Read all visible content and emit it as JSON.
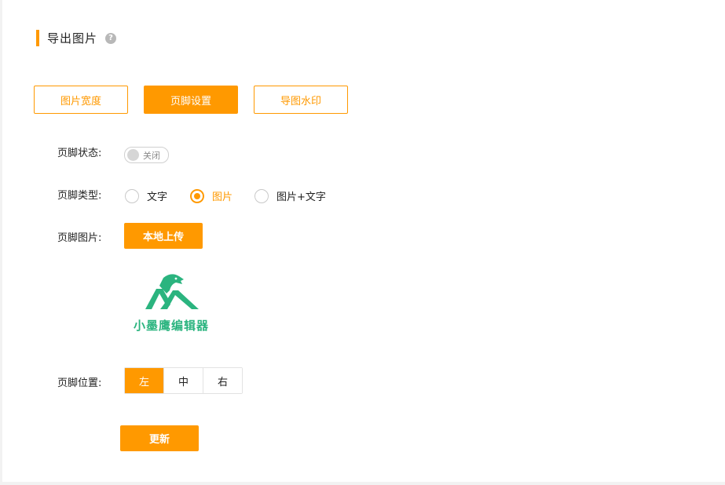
{
  "header": {
    "title": "导出图片",
    "help_icon": "question-circle-icon"
  },
  "tabs": [
    {
      "label": "图片宽度",
      "active": false
    },
    {
      "label": "页脚设置",
      "active": true
    },
    {
      "label": "导图水印",
      "active": false
    }
  ],
  "footer_status": {
    "label": "页脚状态:",
    "toggle_text": "关闭",
    "on": false
  },
  "footer_type": {
    "label": "页脚类型:",
    "options": [
      {
        "label": "文字",
        "checked": false
      },
      {
        "label": "图片",
        "checked": true
      },
      {
        "label": "图片+文字",
        "checked": false
      }
    ]
  },
  "footer_image": {
    "label": "页脚图片:",
    "upload_label": "本地上传",
    "logo_text": "小墨鹰编辑器"
  },
  "footer_position": {
    "label": "页脚位置:",
    "options": [
      "左",
      "中",
      "右"
    ],
    "selected": "左"
  },
  "update_label": "更新",
  "colors": {
    "accent": "#ff9900",
    "logo_green": "#2bb47f"
  }
}
